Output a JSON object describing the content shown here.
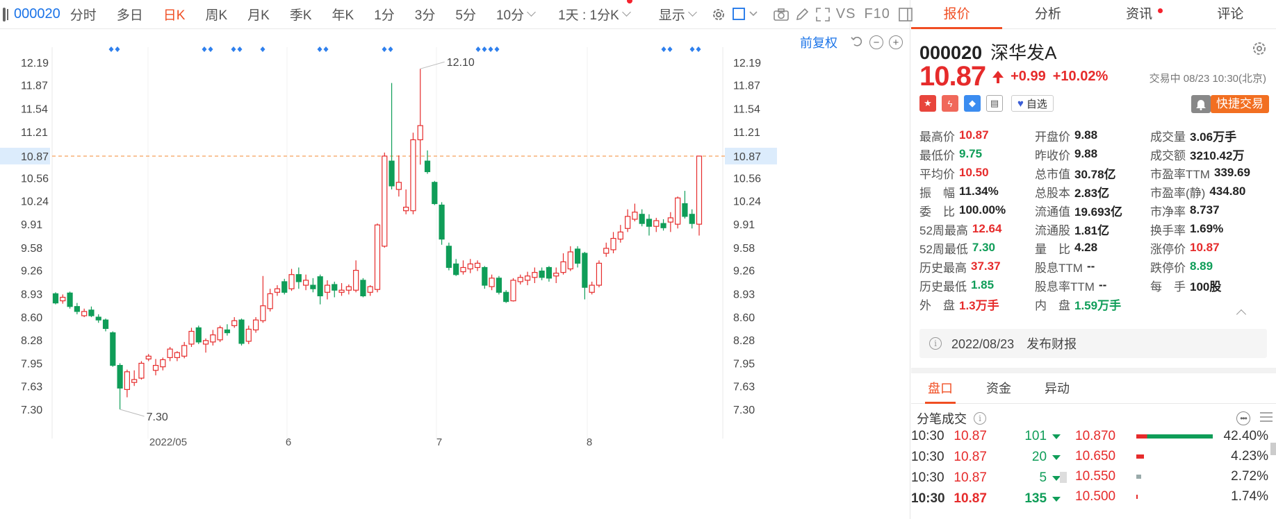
{
  "toolbar": {
    "code": "000020",
    "periods": [
      "分时",
      "多日",
      "日K",
      "周K",
      "月K",
      "季K",
      "年K",
      "1分",
      "3分",
      "5分"
    ],
    "active_period": "日K",
    "minute_select": "10分",
    "range_select": "1天 : 1分K",
    "display_select": "显示",
    "vs_label": "VS",
    "f10_label": "F10"
  },
  "chart_controls": {
    "adjust_label": "前复权"
  },
  "chart_data": {
    "type": "candlestick",
    "y_ticks": [
      "12.19",
      "11.87",
      "11.54",
      "11.21",
      "10.87",
      "10.56",
      "10.24",
      "9.91",
      "9.58",
      "9.26",
      "8.93",
      "8.60",
      "8.28",
      "7.95",
      "7.63",
      "7.30"
    ],
    "ylim": [
      7.3,
      12.19
    ],
    "current_price_label": "10.87",
    "x_labels": [
      "2022/05",
      "6",
      "7",
      "8"
    ],
    "high_annotation": "12.10",
    "low_annotation": "7.30",
    "candles": [
      [
        8.93,
        8.8,
        8.95,
        8.78
      ],
      [
        8.83,
        8.88,
        8.92,
        8.79
      ],
      [
        8.94,
        8.75,
        8.96,
        8.72
      ],
      [
        8.75,
        8.68,
        8.8,
        8.64
      ],
      [
        8.62,
        8.68,
        8.72,
        8.6
      ],
      [
        8.7,
        8.62,
        8.75,
        8.6
      ],
      [
        8.6,
        8.56,
        8.64,
        8.52
      ],
      [
        8.56,
        8.44,
        8.58,
        8.4
      ],
      [
        8.38,
        7.92,
        8.4,
        7.9
      ],
      [
        7.92,
        7.6,
        7.95,
        7.3
      ],
      [
        7.58,
        7.83,
        7.86,
        7.47
      ],
      [
        7.68,
        7.72,
        7.85,
        7.63
      ],
      [
        7.74,
        7.95,
        7.98,
        7.72
      ],
      [
        8.01,
        8.05,
        8.08,
        7.98
      ],
      [
        7.85,
        7.92,
        8.01,
        7.78
      ],
      [
        7.9,
        8.0,
        8.03,
        7.85
      ],
      [
        8.03,
        8.15,
        8.18,
        7.98
      ],
      [
        8.03,
        8.1,
        8.12,
        7.98
      ],
      [
        8.05,
        8.2,
        8.25,
        8.02
      ],
      [
        8.22,
        8.4,
        8.45,
        8.18
      ],
      [
        8.45,
        8.25,
        8.48,
        8.22
      ],
      [
        8.22,
        8.27,
        8.3,
        8.1
      ],
      [
        8.25,
        8.35,
        8.42,
        8.2
      ],
      [
        8.28,
        8.45,
        8.48,
        8.25
      ],
      [
        8.42,
        8.38,
        8.5,
        8.34
      ],
      [
        8.48,
        8.55,
        8.6,
        8.45
      ],
      [
        8.56,
        8.23,
        8.58,
        8.2
      ],
      [
        8.26,
        8.43,
        8.48,
        8.22
      ],
      [
        8.42,
        8.56,
        8.6,
        8.38
      ],
      [
        8.55,
        8.76,
        9.18,
        8.52
      ],
      [
        8.72,
        8.93,
        9.0,
        8.68
      ],
      [
        8.95,
        9.0,
        9.05,
        8.9
      ],
      [
        9.1,
        8.95,
        9.14,
        8.92
      ],
      [
        9.0,
        9.2,
        9.28,
        8.97
      ],
      [
        9.2,
        9.1,
        9.3,
        9.0
      ],
      [
        9.05,
        9.12,
        9.2,
        8.98
      ],
      [
        9.05,
        9.0,
        9.15,
        8.95
      ],
      [
        9.17,
        8.9,
        9.2,
        8.78
      ],
      [
        8.95,
        9.05,
        9.12,
        8.85
      ],
      [
        9.06,
        8.98,
        9.1,
        8.88
      ],
      [
        8.95,
        8.98,
        9.08,
        8.9
      ],
      [
        8.98,
        9.03,
        9.06,
        8.92
      ],
      [
        8.98,
        9.26,
        9.4,
        8.95
      ],
      [
        9.12,
        8.9,
        9.15,
        8.88
      ],
      [
        8.95,
        9.03,
        9.05,
        8.9
      ],
      [
        8.99,
        9.9,
        9.92,
        8.95
      ],
      [
        9.6,
        10.87,
        10.92,
        9.58
      ],
      [
        10.8,
        10.45,
        11.9,
        10.4
      ],
      [
        10.4,
        10.5,
        10.88,
        10.3
      ],
      [
        10.1,
        10.15,
        10.4,
        10.05
      ],
      [
        10.1,
        11.1,
        11.2,
        10.05
      ],
      [
        11.1,
        11.3,
        12.1,
        10.75
      ],
      [
        10.8,
        10.65,
        10.95,
        10.62
      ],
      [
        10.5,
        10.2,
        10.52,
        10.18
      ],
      [
        10.18,
        9.7,
        10.22,
        9.62
      ],
      [
        9.6,
        9.3,
        9.65,
        9.26
      ],
      [
        9.35,
        9.2,
        9.42,
        9.18
      ],
      [
        9.24,
        9.3,
        9.4,
        9.2
      ],
      [
        9.28,
        9.35,
        9.42,
        9.22
      ],
      [
        9.3,
        9.36,
        9.4,
        9.25
      ],
      [
        9.3,
        9.05,
        9.32,
        9.0
      ],
      [
        9.03,
        9.15,
        9.2,
        8.98
      ],
      [
        9.15,
        8.95,
        9.18,
        8.92
      ],
      [
        8.95,
        8.82,
        8.98,
        8.8
      ],
      [
        8.83,
        9.12,
        9.15,
        8.82
      ],
      [
        9.1,
        9.16,
        9.2,
        9.06
      ],
      [
        9.12,
        9.18,
        9.24,
        9.05
      ],
      [
        9.16,
        9.23,
        9.3,
        9.08
      ],
      [
        9.25,
        9.16,
        9.3,
        9.12
      ],
      [
        9.3,
        9.15,
        9.32,
        9.1
      ],
      [
        9.18,
        9.22,
        9.3,
        9.08
      ],
      [
        9.23,
        9.38,
        9.5,
        9.2
      ],
      [
        9.28,
        9.52,
        9.6,
        9.25
      ],
      [
        9.56,
        9.36,
        9.6,
        9.3
      ],
      [
        9.5,
        9.02,
        9.52,
        8.85
      ],
      [
        8.95,
        9.05,
        9.1,
        8.92
      ],
      [
        9.05,
        9.36,
        9.4,
        9.02
      ],
      [
        9.5,
        9.57,
        9.65,
        9.45
      ],
      [
        9.55,
        9.71,
        9.8,
        9.5
      ],
      [
        9.7,
        9.8,
        9.9,
        9.65
      ],
      [
        9.85,
        10.02,
        10.12,
        9.8
      ],
      [
        9.98,
        10.08,
        10.2,
        9.95
      ],
      [
        10.05,
        9.92,
        10.12,
        9.88
      ],
      [
        9.98,
        9.88,
        10.05,
        9.75
      ],
      [
        9.88,
        9.96,
        10.0,
        9.8
      ],
      [
        9.92,
        9.86,
        9.98,
        9.82
      ],
      [
        9.94,
        10.0,
        10.08,
        9.8
      ],
      [
        9.91,
        10.28,
        10.3,
        9.85
      ],
      [
        10.2,
        10.02,
        10.38,
        9.99
      ],
      [
        10.05,
        9.92,
        10.12,
        9.85
      ],
      [
        9.91,
        10.87,
        10.87,
        9.75
      ]
    ],
    "marker_rows": [
      {
        "count": 2
      },
      {
        "count": 2
      },
      {
        "count": 2
      },
      {
        "count": 1
      },
      {
        "count": 2
      },
      {
        "count": 2
      },
      {
        "count": 4
      },
      {
        "count": 2
      },
      {
        "count": 2
      }
    ]
  },
  "tabs": [
    "报价",
    "分析",
    "资讯",
    "评论"
  ],
  "active_tab": "报价",
  "stock": {
    "code": "000020",
    "name": "深华发A",
    "price": "10.87",
    "change": "+0.99",
    "change_pct": "+10.02%",
    "status": "交易中 08/23 10:30(北京)",
    "fav_label": "自选",
    "trade_label": "快捷交易"
  },
  "quote_grid": [
    {
      "k": "最高价",
      "v": "10.87",
      "c": "red"
    },
    {
      "k": "开盘价",
      "v": "9.88",
      "c": ""
    },
    {
      "k": "成交量",
      "v": "3.06万手",
      "c": ""
    },
    {
      "k": "最低价",
      "v": "9.75",
      "c": "green"
    },
    {
      "k": "昨收价",
      "v": "9.88",
      "c": ""
    },
    {
      "k": "成交额",
      "v": "3210.42万",
      "c": ""
    },
    {
      "k": "平均价",
      "v": "10.50",
      "c": "red"
    },
    {
      "k": "总市值",
      "v": "30.78亿",
      "c": ""
    },
    {
      "k": "市盈率TTM",
      "v": "339.69",
      "c": ""
    },
    {
      "k": "振　幅",
      "v": "11.34%",
      "c": ""
    },
    {
      "k": "总股本",
      "v": "2.83亿",
      "c": ""
    },
    {
      "k": "市盈率(静)",
      "v": "434.80",
      "c": ""
    },
    {
      "k": "委　比",
      "v": "100.00%",
      "c": ""
    },
    {
      "k": "流通值",
      "v": "19.693亿",
      "c": ""
    },
    {
      "k": "市净率",
      "v": "8.737",
      "c": ""
    },
    {
      "k": "52周最高",
      "v": "12.64",
      "c": "red"
    },
    {
      "k": "流通股",
      "v": "1.81亿",
      "c": ""
    },
    {
      "k": "换手率",
      "v": "1.69%",
      "c": ""
    },
    {
      "k": "52周最低",
      "v": "7.30",
      "c": "green"
    },
    {
      "k": "量　比",
      "v": "4.28",
      "c": ""
    },
    {
      "k": "涨停价",
      "v": "10.87",
      "c": "red"
    },
    {
      "k": "历史最高",
      "v": "37.37",
      "c": "red"
    },
    {
      "k": "股息TTM",
      "v": "--",
      "c": ""
    },
    {
      "k": "跌停价",
      "v": "8.89",
      "c": "green"
    },
    {
      "k": "历史最低",
      "v": "1.85",
      "c": "green"
    },
    {
      "k": "股息率TTM",
      "v": "--",
      "c": ""
    },
    {
      "k": "每　手",
      "v": "100股",
      "c": ""
    },
    {
      "k": "外　盘",
      "v": "1.3万手",
      "c": "red"
    },
    {
      "k": "内　盘",
      "v": "1.59万手",
      "c": "green"
    },
    {
      "k": "",
      "v": "",
      "c": ""
    }
  ],
  "notice": "2022/08/23　发布财报",
  "bottom_tabs": [
    "盘口",
    "资金",
    "异动"
  ],
  "active_bottom_tab": "盘口",
  "ticks_title": "分笔成交",
  "ticks": [
    {
      "t": "10:30",
      "p": "10.87",
      "v": "101",
      "bold": false
    },
    {
      "t": "10:30",
      "p": "10.87",
      "v": "20",
      "bold": false
    },
    {
      "t": "10:30",
      "p": "10.87",
      "v": "5",
      "bold": false
    },
    {
      "t": "10:30",
      "p": "10.87",
      "v": "135",
      "bold": true
    }
  ],
  "distribution": [
    {
      "price": "10.870",
      "pct": "42.40%",
      "bar": 1.0
    },
    {
      "price": "10.650",
      "pct": "4.23%",
      "bar": 0.1
    },
    {
      "price": "10.550",
      "pct": "2.72%",
      "bar": 0.064
    },
    {
      "price": "10.500",
      "pct": "1.74%",
      "bar": 0.041
    }
  ],
  "colors": {
    "up": "#e62b2b",
    "down": "#0f9d58",
    "accent": "#f04e23",
    "link": "#1a73e8"
  }
}
